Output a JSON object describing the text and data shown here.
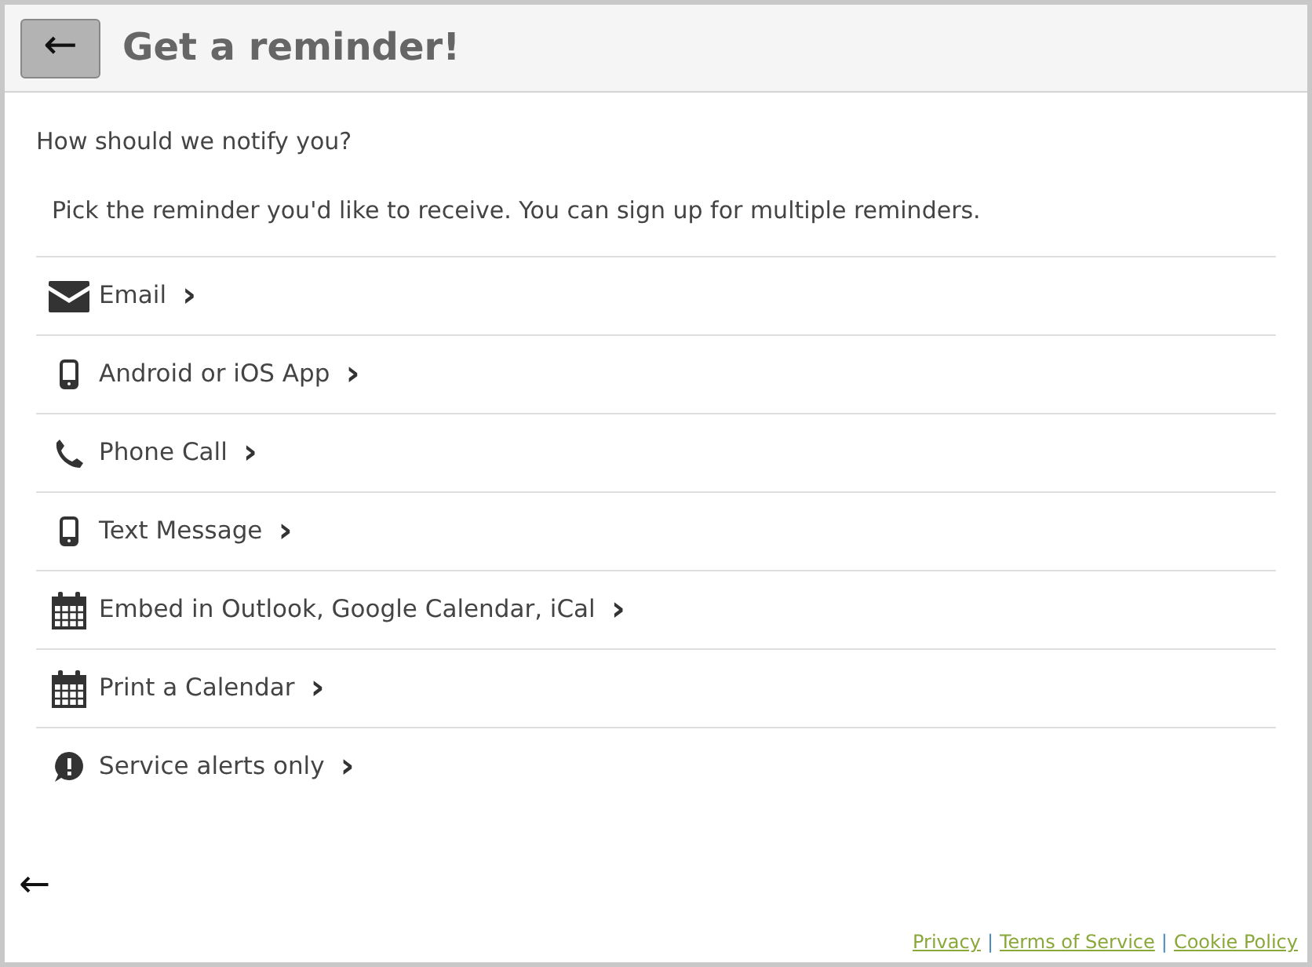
{
  "header": {
    "back": "←",
    "title": "Get a reminder!"
  },
  "question": "How should we notify you?",
  "intro": "Pick the reminder you'd like to receive. You can sign up for multiple reminders.",
  "options": [
    {
      "kind": "email",
      "label": "Email",
      "chevron": "›"
    },
    {
      "kind": "mobile",
      "label": "Android or iOS App",
      "chevron": "›"
    },
    {
      "kind": "phone",
      "label": "Phone Call",
      "chevron": "›"
    },
    {
      "kind": "mobile",
      "label": "Text Message",
      "chevron": "›"
    },
    {
      "kind": "calendar",
      "label": "Embed in Outlook, Google Calendar, iCal",
      "chevron": "›"
    },
    {
      "kind": "calendar",
      "label": "Print a Calendar",
      "chevron": "›"
    },
    {
      "kind": "alert",
      "label": "Service alerts only",
      "chevron": "›"
    }
  ],
  "bottom_back": "←",
  "footer": {
    "links": [
      "Privacy",
      "Terms of Service",
      "Cookie Policy"
    ],
    "separator": "|"
  }
}
